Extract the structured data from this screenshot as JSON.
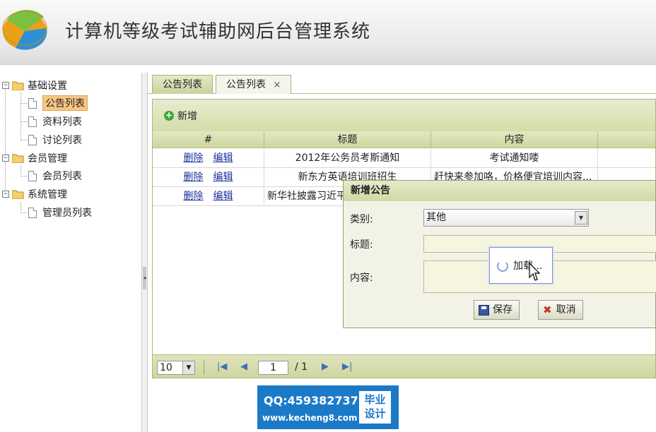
{
  "header": {
    "title": "计算机等级考试辅助网后台管理系统"
  },
  "sidebar": {
    "groups": [
      {
        "label": "基础设置",
        "items": [
          "公告列表",
          "资料列表",
          "讨论列表"
        ]
      },
      {
        "label": "会员管理",
        "items": [
          "会员列表"
        ]
      },
      {
        "label": "系统管理",
        "items": [
          "管理员列表"
        ]
      }
    ],
    "toggle_symbol": "−"
  },
  "tabs": [
    {
      "label": "公告列表",
      "closable": false
    },
    {
      "label": "公告列表",
      "closable": true,
      "close_symbol": "×"
    }
  ],
  "toolbar": {
    "add_label": "新增"
  },
  "grid": {
    "columns": [
      "#",
      "标题",
      "内容"
    ],
    "delete_label": "删除",
    "edit_label": "编辑",
    "rows": [
      {
        "title": "2012年公务员考斯通知",
        "content": "考试通知喽"
      },
      {
        "title": "新东方英语培训班招生",
        "content": "赶快来参加咯，价格便宜培训内容..."
      },
      {
        "title": "新华社披露习近平",
        "content": ""
      }
    ]
  },
  "pager": {
    "page_size": "10",
    "current_page": "1",
    "total_pages": "/ 1"
  },
  "dialog": {
    "title": "新增公告",
    "category_label": "类别:",
    "category_value": "其他",
    "title_label": "标题:",
    "content_label": "内容:",
    "save_label": "保存",
    "cancel_label": "取消"
  },
  "loading": {
    "text": "加载..."
  },
  "watermark": {
    "qq": "QQ:459382737",
    "url": "www.kecheng8.com",
    "tag_line1": "毕业",
    "tag_line2": "设计"
  },
  "colors": {
    "accent_olive": "#d2d8a4",
    "link_blue": "#1d2f9e",
    "selected_orange": "#f7c784",
    "watermark_blue": "#1b7ac8"
  }
}
